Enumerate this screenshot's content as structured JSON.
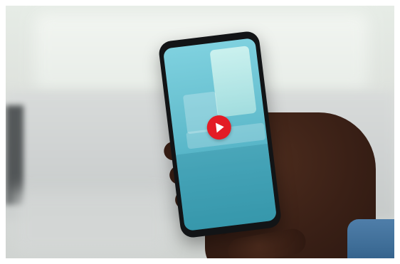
{
  "scene": {
    "subject": "smartphone-video",
    "play_button_color": "#e31c25",
    "screen_tint": "#66bfcf"
  },
  "icons": {
    "play": "play-icon"
  }
}
